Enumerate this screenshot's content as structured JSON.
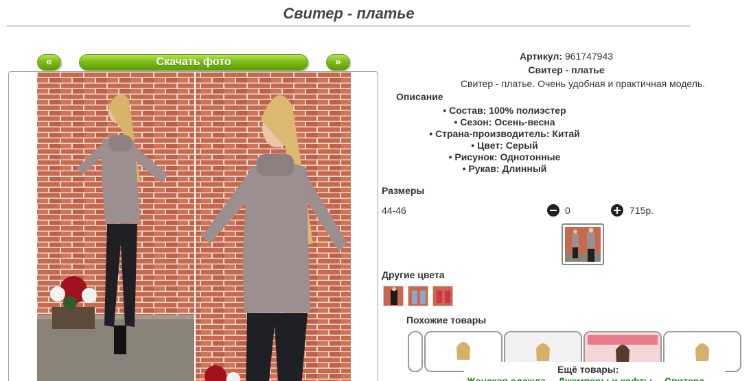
{
  "title": "Свитер - платье",
  "buttons": {
    "prev": "«",
    "download": "Скачать фото",
    "next": "»"
  },
  "product": {
    "article_label": "Артикул:",
    "article_value": "961747943",
    "name": "Свитер - платье",
    "description": "Свитер - платье. Очень удобная и практичная модель.",
    "description_heading": "Описание",
    "specs": [
      "Состав: 100% полиэстер",
      "Сезон: Осень-весна",
      "Страна-производитель: Китай",
      "Цвет: Серый",
      "Рисунок: Однотонные",
      "Рукав: Длинный"
    ]
  },
  "sizes": {
    "heading": "Размеры",
    "items": [
      {
        "size": "44-46",
        "quantity": "0",
        "price": "715р."
      }
    ]
  },
  "other_colors": {
    "heading": "Другие цвета",
    "swatches": [
      "#1b1b1b",
      "#8fa6c4",
      "#d3324a"
    ]
  },
  "similar": {
    "heading": "Похожие товары"
  },
  "more": {
    "heading": "Ещё товары:",
    "links": [
      "Женская одежда",
      "Джемперы и кофты",
      "Свитера"
    ]
  },
  "colors": {
    "accent_green": "#7cbe16",
    "link_green": "#1a7d1a",
    "sweater": "#9c8f8f",
    "brick": "#c96a50"
  }
}
